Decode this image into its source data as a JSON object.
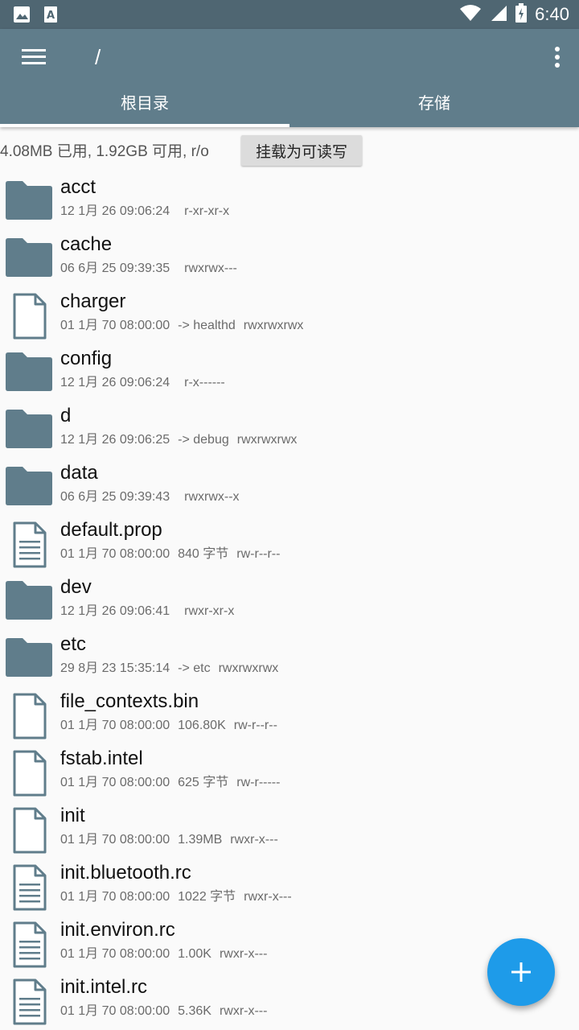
{
  "status_bar": {
    "time": "6:40",
    "icons": [
      "image-icon",
      "font-icon",
      "wifi-icon",
      "signal-icon",
      "battery-icon"
    ]
  },
  "app_bar": {
    "path": "/",
    "tabs": [
      {
        "label": "根目录",
        "active": true
      },
      {
        "label": "存储",
        "active": false
      }
    ]
  },
  "info_bar": {
    "usage": "4.08MB 已用, 1.92GB 可用, r/o",
    "mount_button": "挂载为可读写"
  },
  "colors": {
    "primary": "#607d8b",
    "status_bar": "#4f6672",
    "folder": "#607d8b",
    "fab": "#1e9be9"
  },
  "files": [
    {
      "name": "acct",
      "type": "folder",
      "date": "12 1月 26 09:06:24",
      "extra": "",
      "perms": "r-xr-xr-x"
    },
    {
      "name": "cache",
      "type": "folder",
      "date": "06 6月 25 09:39:35",
      "extra": "",
      "perms": "rwxrwx---"
    },
    {
      "name": "charger",
      "type": "file",
      "date": "01 1月 70 08:00:00",
      "extra": "-> healthd",
      "perms": "rwxrwxrwx"
    },
    {
      "name": "config",
      "type": "folder",
      "date": "12 1月 26 09:06:24",
      "extra": "",
      "perms": "r-x------"
    },
    {
      "name": "d",
      "type": "folder",
      "date": "12 1月 26 09:06:25",
      "extra": "-> debug",
      "perms": "rwxrwxrwx"
    },
    {
      "name": "data",
      "type": "folder",
      "date": "06 6月 25 09:39:43",
      "extra": "",
      "perms": "rwxrwx--x"
    },
    {
      "name": "default.prop",
      "type": "text",
      "date": "01 1月 70 08:00:00",
      "extra": "840 字节",
      "perms": "rw-r--r--"
    },
    {
      "name": "dev",
      "type": "folder",
      "date": "12 1月 26 09:06:41",
      "extra": "",
      "perms": "rwxr-xr-x"
    },
    {
      "name": "etc",
      "type": "folder",
      "date": "29 8月 23 15:35:14",
      "extra": "-> etc",
      "perms": "rwxrwxrwx"
    },
    {
      "name": "file_contexts.bin",
      "type": "file",
      "date": "01 1月 70 08:00:00",
      "extra": "106.80K",
      "perms": "rw-r--r--"
    },
    {
      "name": "fstab.intel",
      "type": "file",
      "date": "01 1月 70 08:00:00",
      "extra": "625 字节",
      "perms": "rw-r-----"
    },
    {
      "name": "init",
      "type": "file",
      "date": "01 1月 70 08:00:00",
      "extra": "1.39MB",
      "perms": "rwxr-x---"
    },
    {
      "name": "init.bluetooth.rc",
      "type": "text",
      "date": "01 1月 70 08:00:00",
      "extra": "1022 字节",
      "perms": "rwxr-x---"
    },
    {
      "name": "init.environ.rc",
      "type": "text",
      "date": "01 1月 70 08:00:00",
      "extra": "1.00K",
      "perms": "rwxr-x---"
    },
    {
      "name": "init.intel.rc",
      "type": "text",
      "date": "01 1月 70 08:00:00",
      "extra": "5.36K",
      "perms": "rwxr-x---"
    }
  ],
  "fab": {
    "icon": "plus-icon"
  }
}
